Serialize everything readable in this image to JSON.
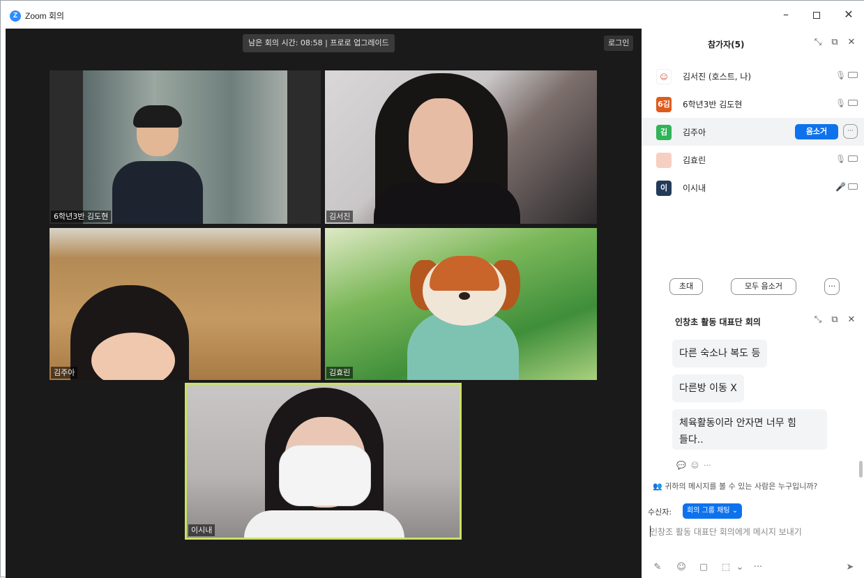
{
  "window": {
    "title": "Zoom 회의"
  },
  "stage": {
    "timer_text": "남은 회의 시간: 08:58 | 프로로 업그레이드",
    "login_label": "로그인",
    "tiles": [
      {
        "name": "6학년3반 김도현"
      },
      {
        "name": "김서진"
      },
      {
        "name": "김주아"
      },
      {
        "name": "김효린"
      },
      {
        "name": "이시내"
      }
    ]
  },
  "participants_panel": {
    "title": "참가자(5)",
    "participants": [
      {
        "avatar_text": "",
        "name": "김서진 (호스트, 나)",
        "avatar_color": "#ffffff"
      },
      {
        "avatar_text": "6김",
        "name": "6학년3반 김도현",
        "avatar_color": "#e05a1c"
      },
      {
        "avatar_text": "김",
        "name": "김주아",
        "avatar_color": "#2fb457",
        "mute_label": "음소거",
        "more_label": "···"
      },
      {
        "avatar_text": "",
        "name": "김효린",
        "avatar_color": "#f7cfc0"
      },
      {
        "avatar_text": "이",
        "name": "이시내",
        "avatar_color": "#233b5a"
      }
    ],
    "invite_label": "초대",
    "mute_all_label": "모두 음소거",
    "more_label": "···"
  },
  "chat": {
    "title": "인창초 활동 대표단 회의",
    "messages": [
      "다른 숙소나 복도 등",
      "다른방 이동 X",
      "체육활동이라 안자면 너무 힘",
      "들다.."
    ],
    "who_can_see": "귀하의 메시지를 볼 수 있는 사람은 누구입니까?",
    "recipient_label": "수신자:",
    "recipient_value": "회의 그룹 채팅",
    "input_placeholder": "인창조 활동 대표단 회의에게 메시지 보내기"
  }
}
